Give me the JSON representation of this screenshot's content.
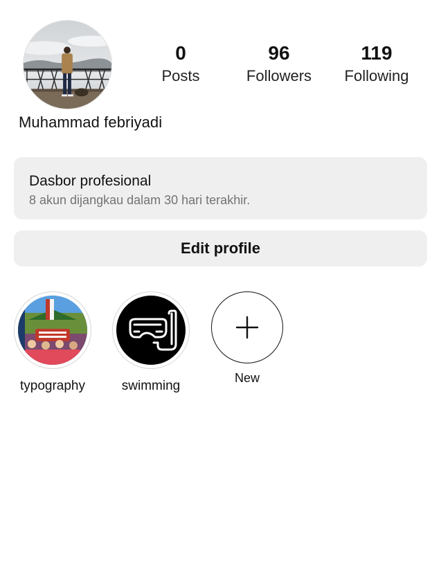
{
  "profile": {
    "username": "Muhammad febriyadi",
    "stats": [
      {
        "value": "0",
        "label": "Posts"
      },
      {
        "value": "96",
        "label": "Followers"
      },
      {
        "value": "119",
        "label": "Following"
      }
    ]
  },
  "dashboard": {
    "title": "Dasbor profesional",
    "subtitle": "8 akun dijangkau dalam 30 hari terakhir."
  },
  "actions": {
    "edit_profile_label": "Edit profile"
  },
  "highlights": [
    {
      "label": "typography",
      "icon": "typography-photo-thumbnail"
    },
    {
      "label": "swimming",
      "icon": "snorkel-mask-icon"
    },
    {
      "label": "New",
      "icon": "plus-icon"
    }
  ]
}
